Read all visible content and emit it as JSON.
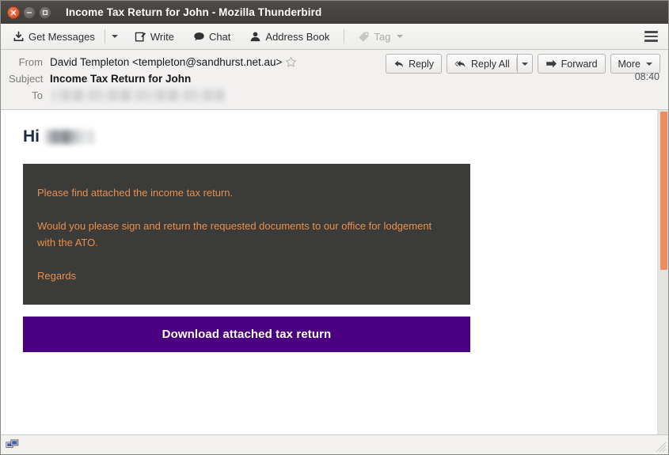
{
  "window": {
    "title": "Income Tax Return for John - Mozilla Thunderbird",
    "close_label": "×",
    "minimize_label": "−",
    "maximize_label": "□"
  },
  "toolbar": {
    "get_messages": "Get Messages",
    "write": "Write",
    "chat": "Chat",
    "address_book": "Address Book",
    "tag": "Tag",
    "menu_icon": "hamburger-menu-icon"
  },
  "message_header": {
    "from_label": "From",
    "from_value": "David Templeton <templeton@sandhurst.net.au>",
    "subject_label": "Subject",
    "subject_value": "Income Tax Return for John",
    "to_label": "To",
    "to_value": "",
    "timestamp": "08:40",
    "star_icon": "star-outline-icon"
  },
  "actions": {
    "reply": "Reply",
    "reply_all": "Reply All",
    "forward": "Forward",
    "more": "More"
  },
  "body": {
    "greeting": "Hi",
    "greeting_name": "",
    "paragraphs": [
      "Please find attached the income tax return.",
      "Would you please sign and return the requested documents to our office for lodgement with the ATO.",
      "Regards"
    ],
    "cta_label": "Download attached tax return",
    "panel_bg": "#3b3b39",
    "panel_text_color": "#e9904e",
    "cta_bg": "#4b0082",
    "cta_text_color": "#ffffff"
  },
  "statusbar": {
    "network_icon": "network-connection-icon"
  },
  "scrollbar": {
    "thumb_color": "#ef8b5f",
    "track_color": "#e4e3e1"
  }
}
